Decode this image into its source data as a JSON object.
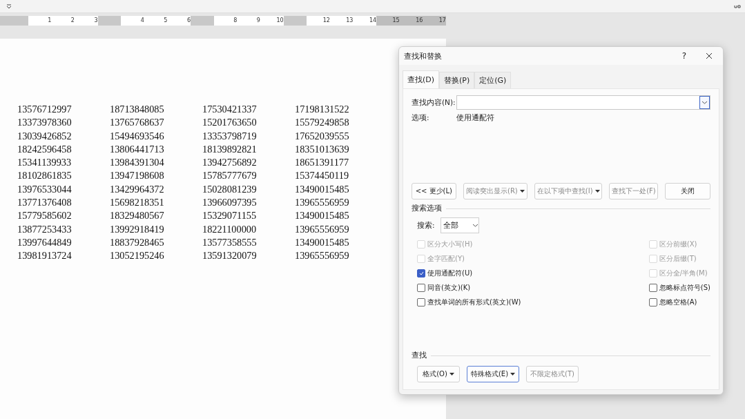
{
  "ruler": [
    {
      "kind": "number",
      "label": "1"
    },
    {
      "kind": "number",
      "label": "2"
    },
    {
      "kind": "number",
      "label": "3"
    },
    {
      "kind": "gap"
    },
    {
      "kind": "number",
      "label": "4"
    },
    {
      "kind": "number",
      "label": "5"
    },
    {
      "kind": "number",
      "label": "6"
    },
    {
      "kind": "gap"
    },
    {
      "kind": "number",
      "label": "8"
    },
    {
      "kind": "number",
      "label": "9"
    },
    {
      "kind": "number",
      "label": "10"
    },
    {
      "kind": "gap"
    },
    {
      "kind": "number",
      "label": "12"
    },
    {
      "kind": "number",
      "label": "13"
    },
    {
      "kind": "number",
      "label": "14"
    },
    {
      "kind": "margin",
      "label": "15"
    },
    {
      "kind": "margin",
      "label": "16"
    },
    {
      "kind": "margin",
      "label": "17"
    }
  ],
  "document": {
    "rows": [
      [
        "13576712997",
        "18713848085",
        "17530421337",
        "17198131522"
      ],
      [
        "13373978360",
        "13765768637",
        "15201763650",
        "15579249858"
      ],
      [
        "13039426852",
        "15494693546",
        "13353798719",
        "17652039555"
      ],
      [
        "18242596458",
        "13806441713",
        "18139892821",
        "18351013639"
      ],
      [
        "15341139933",
        "13984391304",
        "13942756892",
        "18651391177"
      ],
      [
        "18102861835",
        "13947198608",
        "15785777679",
        "15374450119"
      ],
      [
        "13976533044",
        "13429964372",
        "15028081239",
        "13490015485"
      ],
      [
        "13771376408",
        "15698218351",
        "13966097395",
        "13965556959"
      ],
      [
        "15779585602",
        "18329480567",
        "15329071155",
        "13490015485"
      ],
      [
        "13877253433",
        "13992918419",
        "18221100000",
        "13965556959"
      ],
      [
        "13997644849",
        "18837928465",
        "13577358555",
        "13490015485"
      ],
      [
        "13981913724",
        "13052195246",
        "13591320079",
        "13965556959"
      ]
    ]
  },
  "dialog": {
    "title": "查找和替换",
    "help": "?",
    "tabs": [
      {
        "label": "查找(D)",
        "selected": true
      },
      {
        "label": "替换(P)",
        "selected": false
      },
      {
        "label": "定位(G)",
        "selected": false
      }
    ],
    "find_field": {
      "label": "查找内容(N):"
    },
    "options_label": "选项:",
    "options_value": "使用通配符",
    "buttons": [
      {
        "label": "<< 更少(L)",
        "disabled": false,
        "dropdown": false
      },
      {
        "label": "阅读突出显示(R)",
        "disabled": true,
        "dropdown": true
      },
      {
        "label": "在以下项中查找(I)",
        "disabled": true,
        "dropdown": true
      },
      {
        "label": "查找下一处(F)",
        "disabled": true,
        "dropdown": false
      },
      {
        "label": "关闭",
        "disabled": false,
        "dropdown": false
      }
    ],
    "search_options": {
      "title": "搜索选项",
      "search_label": "搜索:",
      "search_value": "全部",
      "left": [
        {
          "label": "区分大小写(H)",
          "checked": false,
          "disabled": true
        },
        {
          "label": "全字匹配(Y)",
          "checked": false,
          "disabled": true
        },
        {
          "label": "使用通配符(U)",
          "checked": true,
          "disabled": false
        },
        {
          "label": "同音(英文)(K)",
          "checked": false,
          "disabled": false
        },
        {
          "label": "查找单词的所有形式(英文)(W)",
          "checked": false,
          "disabled": false
        }
      ],
      "right": [
        {
          "label": "区分前缀(X)",
          "checked": false,
          "disabled": true
        },
        {
          "label": "区分后缀(T)",
          "checked": false,
          "disabled": true
        },
        {
          "label": "区分全/半角(M)",
          "checked": false,
          "disabled": true
        },
        {
          "label": "忽略标点符号(S)",
          "checked": false,
          "disabled": false
        },
        {
          "label": "忽略空格(A)",
          "checked": false,
          "disabled": false
        }
      ]
    },
    "find_section": {
      "title": "查找",
      "buttons": [
        {
          "label": "格式(O)",
          "disabled": false,
          "dropdown": true,
          "focused": false
        },
        {
          "label": "特殊格式(E)",
          "disabled": false,
          "dropdown": true,
          "focused": true
        },
        {
          "label": "不限定格式(T)",
          "disabled": true,
          "dropdown": false,
          "focused": false
        }
      ]
    }
  }
}
